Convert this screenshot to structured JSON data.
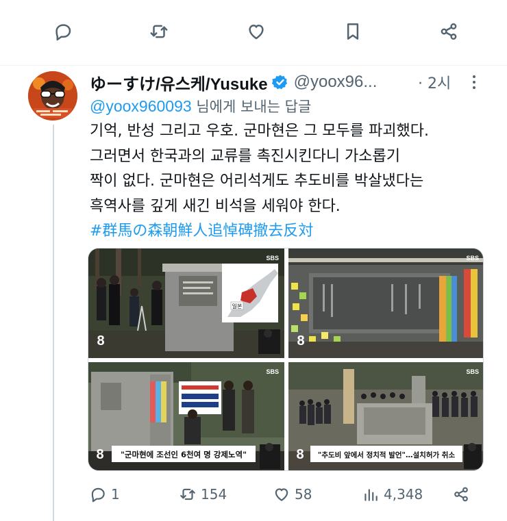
{
  "top_actions": [
    {
      "icon": "reply-icon"
    },
    {
      "icon": "retweet-icon"
    },
    {
      "icon": "like-icon"
    },
    {
      "icon": "bookmark-icon"
    },
    {
      "icon": "share-icon"
    }
  ],
  "tweet": {
    "display_name": "ゆーすけ/유스케/Yusuke",
    "handle": "@yoox96...",
    "separator_time": "· 2시",
    "reply_to_handle": "@yoox960093",
    "reply_to_suffix": " 님에게 보내는 답글",
    "text_lines": [
      "기억, 반성 그리고 우호. 군마현은 그 모두를 파괴했다.",
      "그러면서 한국과의 교류를 촉진시킨다니 가소롭기",
      "짝이 없다. 군마현은 어리석게도 추도비를 박살냈다는",
      "흑역사를 깊게 새긴 비석을 세워야 한다."
    ],
    "hashtag": "#群馬の森朝鮮人追悼碑撤去反対",
    "accent_color": "#1d9bf0",
    "verified_color": "#1d9bf0"
  },
  "media": {
    "top_left": {
      "broadcaster": "SBS",
      "map_label": "일본",
      "channel": "8"
    },
    "top_right": {
      "broadcaster": "SBS",
      "channel": "8"
    },
    "bottom_left": {
      "broadcaster": "SBS",
      "channel": "8",
      "caption": "\"군마현에 조선인 6천여 명 강제노역\""
    },
    "bottom_right": {
      "broadcaster": "SBS",
      "channel": "8",
      "caption": "\"추도비 앞에서 정치적 발언\"…설치허가 취소"
    }
  },
  "stats": {
    "replies": "1",
    "retweets": "154",
    "likes": "58",
    "views": "4,348"
  }
}
